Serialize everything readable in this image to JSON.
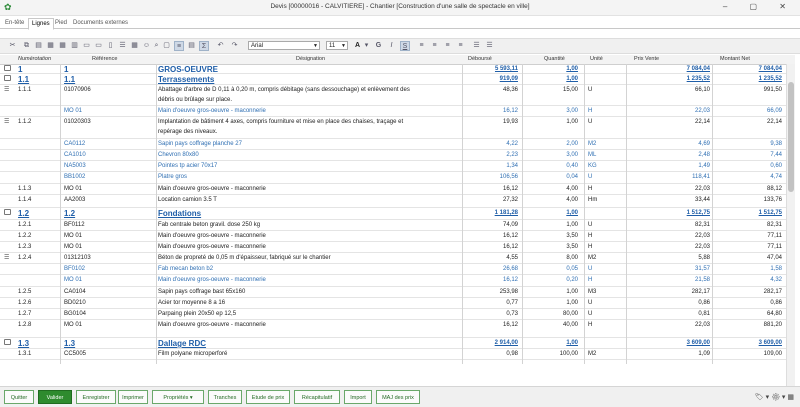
{
  "window": {
    "title": "Devis [00000016 - CALVITIERE] - Chantier [Construction d'une salle de spectacle en ville]",
    "controls": "–  ▢  ✕"
  },
  "tabs": [
    "En-tête",
    "Lignes",
    "Pied",
    "Documents externes"
  ],
  "toolbar": {
    "font": "Arial",
    "size": "11"
  },
  "columns": {
    "num": "Numérotation",
    "ref": "Référence",
    "des": "Désignation",
    "deb": "Déboursé",
    "qte": "Quantité",
    "unit": "Unité",
    "pv": "Prix Vente",
    "mn": "Montant Net"
  },
  "rows": [
    {
      "num": "1",
      "ref": "1",
      "des": "GROS-OEUVRE",
      "deb": "5 593,11",
      "qte": "1,00",
      "unit": "",
      "pv": "7 084,04",
      "mn": "7 084,04"
    },
    {
      "num": "1.1",
      "ref": "1.1",
      "des": "Terrassements",
      "deb": "919,09",
      "qte": "1,00",
      "unit": "",
      "pv": "1 235,52",
      "mn": "1 235,52"
    },
    {
      "num": "1.1.1",
      "ref": "01070906",
      "des": "Abattage d'arbre de D 0,11 à 0,20 m, compris débitage (sans dessouchage) et enlèvement des",
      "deb": "48,36",
      "qte": "15,00",
      "unit": "U",
      "pv": "66,10",
      "mn": "991,50"
    },
    {
      "num": "",
      "ref": "",
      "des": "débris ou brûlage sur place.",
      "deb": "",
      "qte": "",
      "unit": "",
      "pv": "",
      "mn": ""
    },
    {
      "num": "",
      "ref": "MO 01",
      "des": "Main d'oeuvre gros-oeuvre - maconnerie",
      "deb": "16,12",
      "qte": "3,00",
      "unit": "H",
      "pv": "22,03",
      "mn": "66,09"
    },
    {
      "num": "1.1.2",
      "ref": "01020303",
      "des": "Implantation de bâtiment 4 axes, compris fourniture et mise en place des chaises, traçage et",
      "deb": "19,93",
      "qte": "1,00",
      "unit": "U",
      "pv": "22,14",
      "mn": "22,14"
    },
    {
      "num": "",
      "ref": "",
      "des": "repérage des niveaux.",
      "deb": "",
      "qte": "",
      "unit": "",
      "pv": "",
      "mn": ""
    },
    {
      "num": "",
      "ref": "CA0112",
      "des": "Sapin pays coffrage planche 27",
      "deb": "4,22",
      "qte": "2,00",
      "unit": "M2",
      "pv": "4,69",
      "mn": "9,38"
    },
    {
      "num": "",
      "ref": "CA1010",
      "des": "Chevron 80x80",
      "deb": "2,23",
      "qte": "3,00",
      "unit": "ML",
      "pv": "2,48",
      "mn": "7,44"
    },
    {
      "num": "",
      "ref": "NA5003",
      "des": "Pointes tp acier 70x17",
      "deb": "1,34",
      "qte": "0,40",
      "unit": "KG",
      "pv": "1,49",
      "mn": "0,60"
    },
    {
      "num": "",
      "ref": "BB1002",
      "des": "Platre gros",
      "deb": "106,56",
      "qte": "0,04",
      "unit": "U",
      "pv": "118,41",
      "mn": "4,74"
    },
    {
      "num": "1.1.3",
      "ref": "MO 01",
      "des": "Main d'oeuvre gros-oeuvre - maconnerie",
      "deb": "16,12",
      "qte": "4,00",
      "unit": "H",
      "pv": "22,03",
      "mn": "88,12"
    },
    {
      "num": "1.1.4",
      "ref": "AA2003",
      "des": "Location camion 3.5 T",
      "deb": "27,32",
      "qte": "4,00",
      "unit": "Hm",
      "pv": "33,44",
      "mn": "133,76"
    },
    {
      "num": "1.2",
      "ref": "1.2",
      "des": "Fondations",
      "deb": "1 181,28",
      "qte": "1,00",
      "unit": "",
      "pv": "1 512,75",
      "mn": "1 512,75"
    },
    {
      "num": "1.2.1",
      "ref": "BF0112",
      "des": "Fab centrale beton gravil. dose 250 kg",
      "deb": "74,09",
      "qte": "1,00",
      "unit": "U",
      "pv": "82,31",
      "mn": "82,31"
    },
    {
      "num": "1.2.2",
      "ref": "MO 01",
      "des": "Main d'oeuvre gros-oeuvre - maconnerie",
      "deb": "16,12",
      "qte": "3,50",
      "unit": "H",
      "pv": "22,03",
      "mn": "77,11"
    },
    {
      "num": "1.2.3",
      "ref": "MO 01",
      "des": "Main d'oeuvre gros-oeuvre - maconnerie",
      "deb": "16,12",
      "qte": "3,50",
      "unit": "H",
      "pv": "22,03",
      "mn": "77,11"
    },
    {
      "num": "1.2.4",
      "ref": "01312103",
      "des": "Béton de propreté de 0,05 m d'épaisseur, fabriqué sur le chantier",
      "deb": "4,55",
      "qte": "8,00",
      "unit": "M2",
      "pv": "5,88",
      "mn": "47,04"
    },
    {
      "num": "",
      "ref": "BF0102",
      "des": "Fab mecan beton b2",
      "deb": "26,68",
      "qte": "0,05",
      "unit": "U",
      "pv": "31,57",
      "mn": "1,58"
    },
    {
      "num": "",
      "ref": "MO 01",
      "des": "Main d'oeuvre gros-oeuvre - maconnerie",
      "deb": "16,12",
      "qte": "0,20",
      "unit": "H",
      "pv": "21,58",
      "mn": "4,32"
    },
    {
      "num": "1.2.5",
      "ref": "CA0104",
      "des": "Sapin pays coffrage bast 65x160",
      "deb": "253,98",
      "qte": "1,00",
      "unit": "M3",
      "pv": "282,17",
      "mn": "282,17"
    },
    {
      "num": "1.2.6",
      "ref": "BD0210",
      "des": "Acier tor moyenne 8 a 16",
      "deb": "0,77",
      "qte": "1,00",
      "unit": "U",
      "pv": "0,86",
      "mn": "0,86"
    },
    {
      "num": "1.2.7",
      "ref": "BG0104",
      "des": "Parpaing plein 20x50 ep 12,5",
      "deb": "0,73",
      "qte": "80,00",
      "unit": "U",
      "pv": "0,81",
      "mn": "64,80"
    },
    {
      "num": "1.2.8",
      "ref": "MO 01",
      "des": "Main d'oeuvre gros-oeuvre - maconnerie",
      "deb": "16,12",
      "qte": "40,00",
      "unit": "H",
      "pv": "22,03",
      "mn": "881,20"
    },
    {
      "num": "1.3",
      "ref": "1.3",
      "des": "Dallage RDC",
      "deb": "2 914,00",
      "qte": "1,00",
      "unit": "",
      "pv": "3 609,00",
      "mn": "3 609,00"
    },
    {
      "num": "1.3.1",
      "ref": "CC5005",
      "des": "Film polyane microperforé",
      "deb": "0,98",
      "qte": "100,00",
      "unit": "M2",
      "pv": "1,09",
      "mn": "109,00"
    }
  ],
  "footer": [
    "Quitter",
    "Valider",
    "Enregistrer",
    "Imprimer",
    "Propriétés",
    "Tranches",
    "Etude de prix",
    "Récapitulatif",
    "Import",
    "MAJ des prix"
  ]
}
